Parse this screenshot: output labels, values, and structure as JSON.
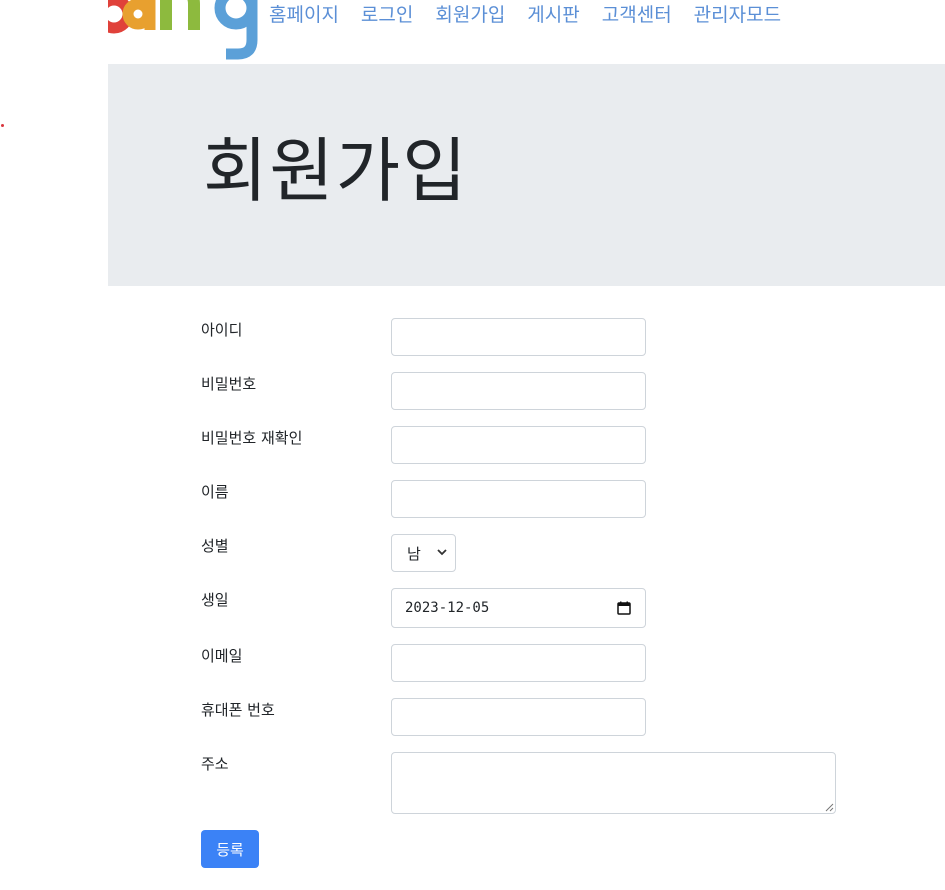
{
  "nav": {
    "links": [
      "홈페이지",
      "로그인",
      "회원가입",
      "게시판",
      "고객센터",
      "관리자모드"
    ]
  },
  "jumbotron": {
    "title": "회원가입"
  },
  "form": {
    "id_label": "아이디",
    "password_label": "비밀번호",
    "password_confirm_label": "비밀번호 재확인",
    "name_label": "이름",
    "gender_label": "성별",
    "gender_selected": "남",
    "birth_label": "생일",
    "birth_value": "2023-12-05",
    "email_label": "이메일",
    "phone_label": "휴대폰 번호",
    "address_label": "주소",
    "submit_label": "등록"
  },
  "colors": {
    "nav_link": "#5b8fd6",
    "jumbotron_bg": "#e9ecef",
    "primary_button": "#3b82f6",
    "input_border": "#ced4da"
  },
  "icons": {
    "logo": "site-logo",
    "select_arrow": "chevron-down-icon",
    "date_picker": "calendar-icon",
    "resize_grip": "resize-grip-icon"
  }
}
